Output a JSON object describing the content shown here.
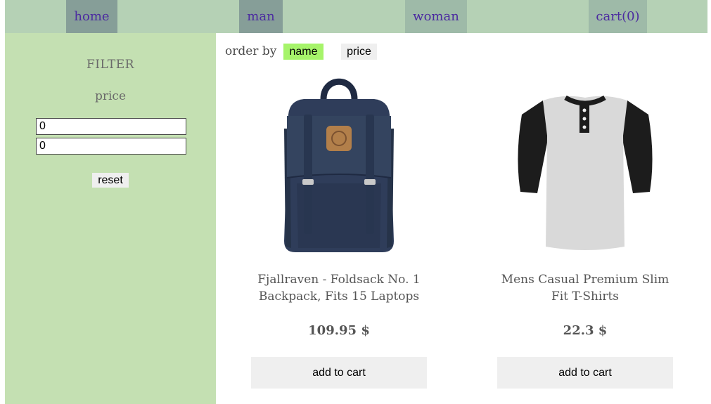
{
  "nav": {
    "items": [
      {
        "label": "home",
        "bg": "#869e98"
      },
      {
        "label": "man",
        "bg": "#869e98"
      },
      {
        "label": "woman",
        "bg": "#9ebaa8"
      },
      {
        "label": "cart(0)",
        "bg": "#9ebaa8"
      }
    ]
  },
  "sidebar": {
    "title": "FILTER",
    "price_label": "price",
    "min_value": "0",
    "max_value": "0",
    "reset_label": "reset"
  },
  "sort": {
    "label": "order by",
    "name_label": "name",
    "price_label": "price",
    "active": "name",
    "active_color": "#a6f46a",
    "inactive_color": "#efefef"
  },
  "products": [
    {
      "name": "Fjallraven - Foldsack No. 1 Backpack, Fits 15 Laptops",
      "price": "109.95",
      "currency": "$",
      "button": "add to cart",
      "image": "backpack"
    },
    {
      "name": "Mens Casual Premium Slim Fit T-Shirts",
      "price": "22.3",
      "currency": "$",
      "button": "add to cart",
      "image": "raglan-shirt"
    }
  ]
}
